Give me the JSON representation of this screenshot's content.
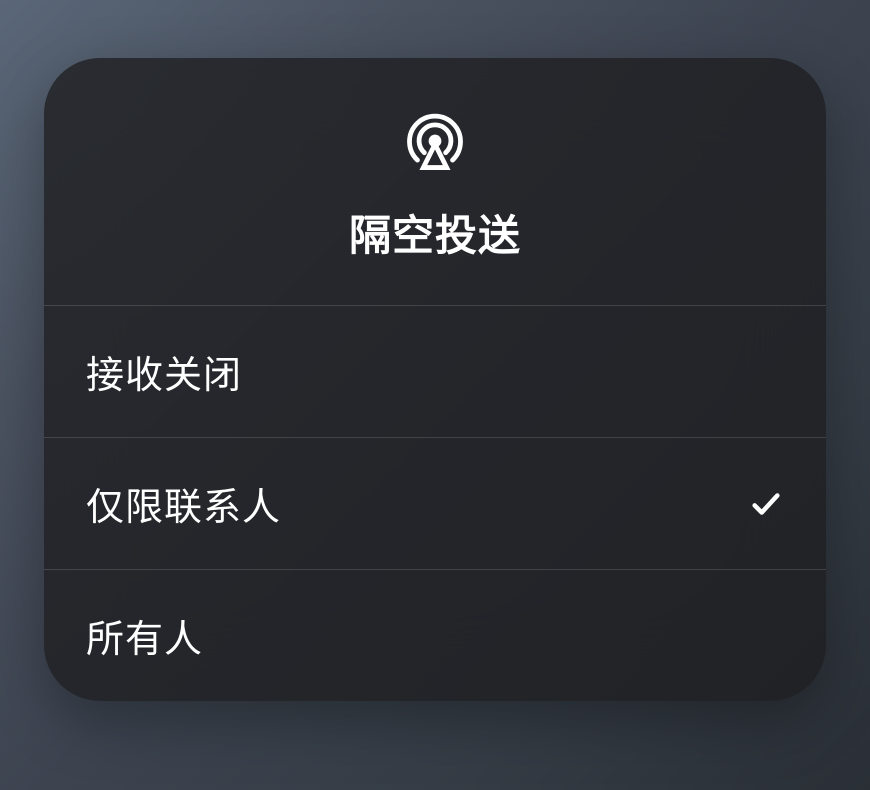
{
  "header": {
    "title": "隔空投送",
    "icon": "airdrop-icon"
  },
  "options": [
    {
      "id": "off",
      "label": "接收关闭",
      "selected": false
    },
    {
      "id": "contacts-only",
      "label": "仅限联系人",
      "selected": true
    },
    {
      "id": "everyone",
      "label": "所有人",
      "selected": false
    }
  ]
}
